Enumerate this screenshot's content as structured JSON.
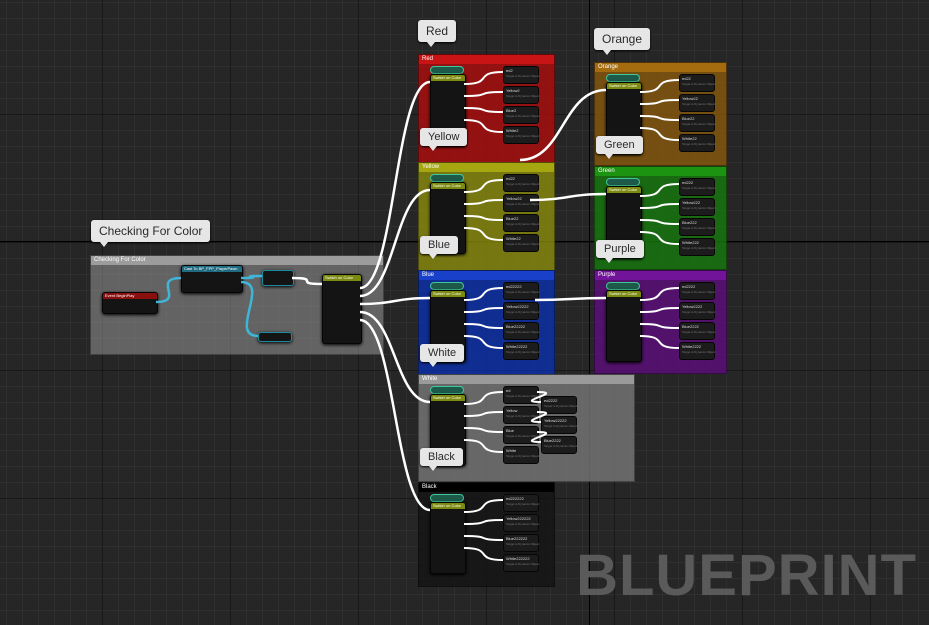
{
  "main_comment": {
    "bubble": "Checking For Color",
    "title": "Checking For Color"
  },
  "nodes": {
    "event": "Event BeginPlay",
    "cast": "Cast To BP_FPP_PlayerPawn",
    "switch": "Switch on Color"
  },
  "groups": [
    {
      "key": "red",
      "bubble": "Red",
      "title": "Red",
      "color": "#b00d0d",
      "bar": "#c81414",
      "cast_bubble": "Yellow",
      "outputs": [
        "ed2",
        "Yellow2",
        "Blue2",
        "White2"
      ]
    },
    {
      "key": "yellow",
      "bubble": "Yellow",
      "title": "Yellow",
      "color": "#8c8c0c",
      "bar": "#a6a611",
      "cast_bubble": "Blue",
      "outputs": [
        "ed22",
        "Yellow22",
        "Blue22",
        "White22"
      ]
    },
    {
      "key": "blue",
      "bubble": "Blue",
      "title": "Blue",
      "color": "#0b2fae",
      "bar": "#1840c8",
      "cast_bubble": "White",
      "outputs": [
        "ed22222",
        "Yellow22222",
        "Blue22222",
        "White22222"
      ]
    },
    {
      "key": "white",
      "bubble": "White",
      "title": "White",
      "color": "#787878",
      "bar": "#9a9a9a",
      "cast_bubble": "Black",
      "outputs": [
        "ed",
        "Yellow",
        "Blue",
        "White"
      ],
      "extra": [
        "ed2222",
        "Yellow22222",
        "Blue2222"
      ]
    },
    {
      "key": "black",
      "bubble": "Black",
      "title": "Black",
      "color": "#141414",
      "bar": "#000000",
      "outputs": [
        "ed222222",
        "Yellow222222",
        "Blue222222",
        "White222222"
      ]
    },
    {
      "key": "orange",
      "bubble": "Orange",
      "title": "Orange",
      "color": "#8a5a0c",
      "bar": "#a46c0e",
      "cast_bubble": "Green",
      "outputs": [
        "ed22",
        "Yellow22",
        "Blue22",
        "White22"
      ]
    },
    {
      "key": "green",
      "bubble": "Green",
      "title": "Green",
      "color": "#177a0e",
      "bar": "#1d9411",
      "cast_bubble": "Purple",
      "outputs": [
        "ed222",
        "Yellow222",
        "Blue222",
        "White222"
      ]
    },
    {
      "key": "purple",
      "bubble": "Purple",
      "title": "Purple",
      "color": "#5e0e7e",
      "bar": "#71149a",
      "outputs": [
        "ed2222",
        "Yellow2222",
        "Blue2222",
        "White2222"
      ]
    }
  ],
  "sub_label": "Target is Dynamic Object",
  "watermark": "BLUEPRINT"
}
